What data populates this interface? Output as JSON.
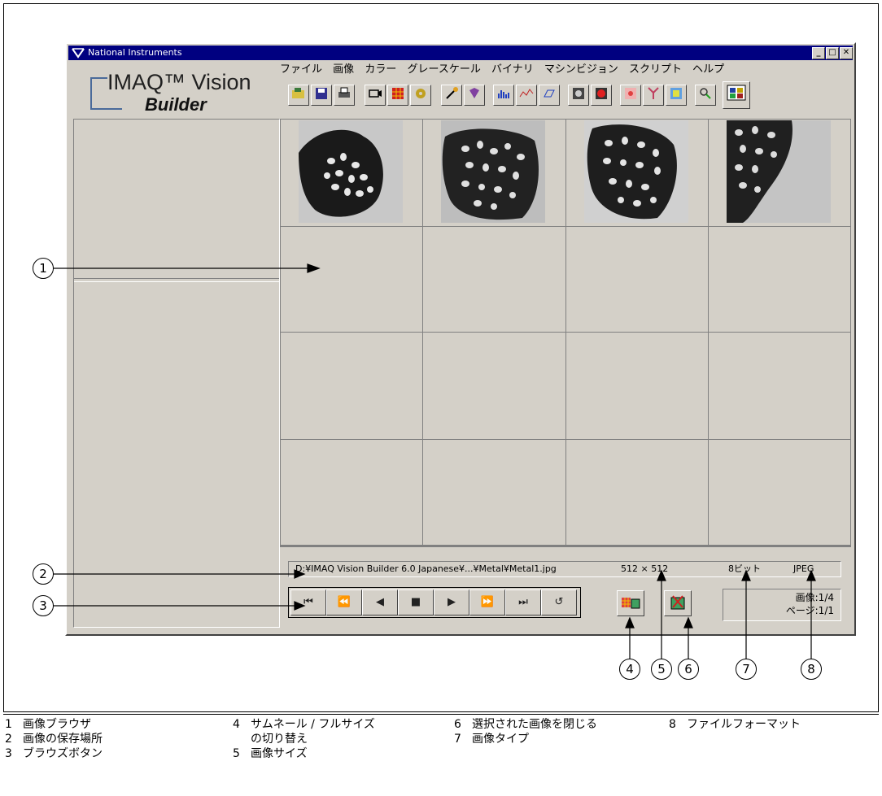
{
  "window": {
    "title": "National Instruments",
    "minimize": "_",
    "maximize": "□",
    "close": "✕"
  },
  "logo": {
    "line1": "IMAQ™ Vision",
    "line2": "Builder"
  },
  "menu": [
    "ファイル",
    "画像",
    "カラー",
    "グレースケール",
    "バイナリ",
    "マシンビジョン",
    "スクリプト",
    "ヘルプ"
  ],
  "toolbar_icons": [
    "open-file-icon",
    "save-file-icon",
    "print-icon",
    "acquire-icon",
    "grid-icon",
    "settings-icon",
    "wand-icon",
    "book-icon",
    "histogram-icon",
    "line-profile-icon",
    "3d-view-icon",
    "grayscale-image-icon",
    "color-image-icon",
    "pattern-icon",
    "tree-icon",
    "colormap-icon",
    "zoom-icon",
    "browser-icon"
  ],
  "status": {
    "path": "D:¥IMAQ Vision Builder 6.0 Japanese¥...¥Metal¥Metal1.jpg",
    "size": "512 × 512",
    "bits": "8ビット",
    "format": "JPEG"
  },
  "nav_buttons": [
    "⏮",
    "⏪",
    "◀",
    "■",
    "▶",
    "⏩",
    "⏭",
    "↺"
  ],
  "info": {
    "image": "画像:1/4",
    "page": "ページ:1/1"
  },
  "callouts": [
    "1",
    "2",
    "3",
    "4",
    "5",
    "6",
    "7",
    "8"
  ],
  "legend": [
    {
      "num": "1",
      "text": "画像ブラウザ"
    },
    {
      "num": "2",
      "text": "画像の保存場所"
    },
    {
      "num": "3",
      "text": "ブラウズボタン"
    },
    {
      "num": "4",
      "text": "サムネール / フルサイズ"
    },
    {
      "num": "",
      "text": "の切り替え"
    },
    {
      "num": "5",
      "text": "画像サイズ"
    },
    {
      "num": "6",
      "text": "選択された画像を閉じる"
    },
    {
      "num": "7",
      "text": "画像タイプ"
    },
    {
      "num": "8",
      "text": "ファイルフォーマット"
    }
  ]
}
